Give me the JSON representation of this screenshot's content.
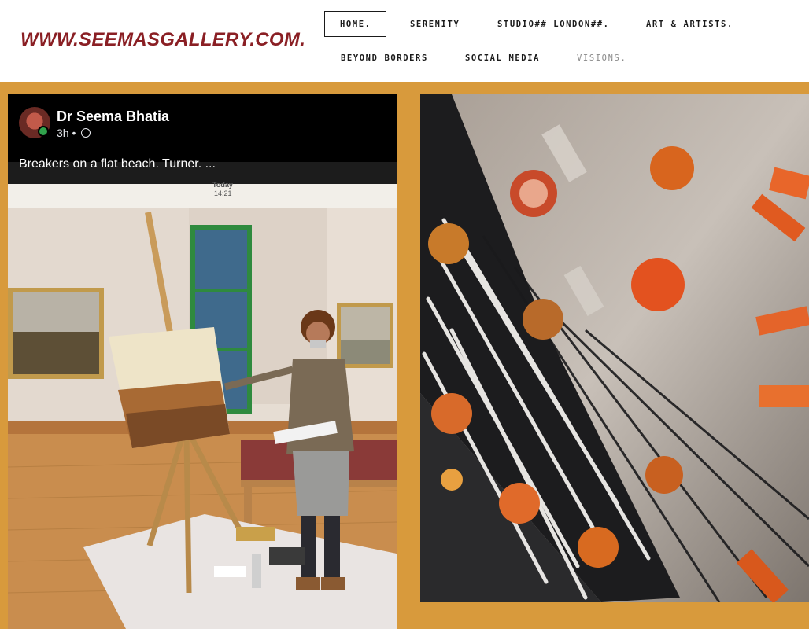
{
  "site": {
    "logo": "WWW.SEEMASGALLERY.COM."
  },
  "nav": {
    "items": [
      {
        "label": "HOME."
      },
      {
        "label": "SERENITY"
      },
      {
        "label": "STUDIO## LONDON##."
      },
      {
        "label": "ART & ARTISTS."
      },
      {
        "label": "BEYOND BORDERS"
      },
      {
        "label": "SOCIAL MEDIA"
      },
      {
        "label": "VISIONS."
      }
    ],
    "active": "HOME."
  },
  "post": {
    "author": "Dr Seema Bhatia",
    "time": "3h",
    "caption": "Breakers on a flat beach. Turner. ...",
    "stamp_day": "Today",
    "stamp_time": "14:21"
  },
  "colors": {
    "brand": "#8a1f24",
    "band": "#d89a3c",
    "online": "#31a24c"
  }
}
